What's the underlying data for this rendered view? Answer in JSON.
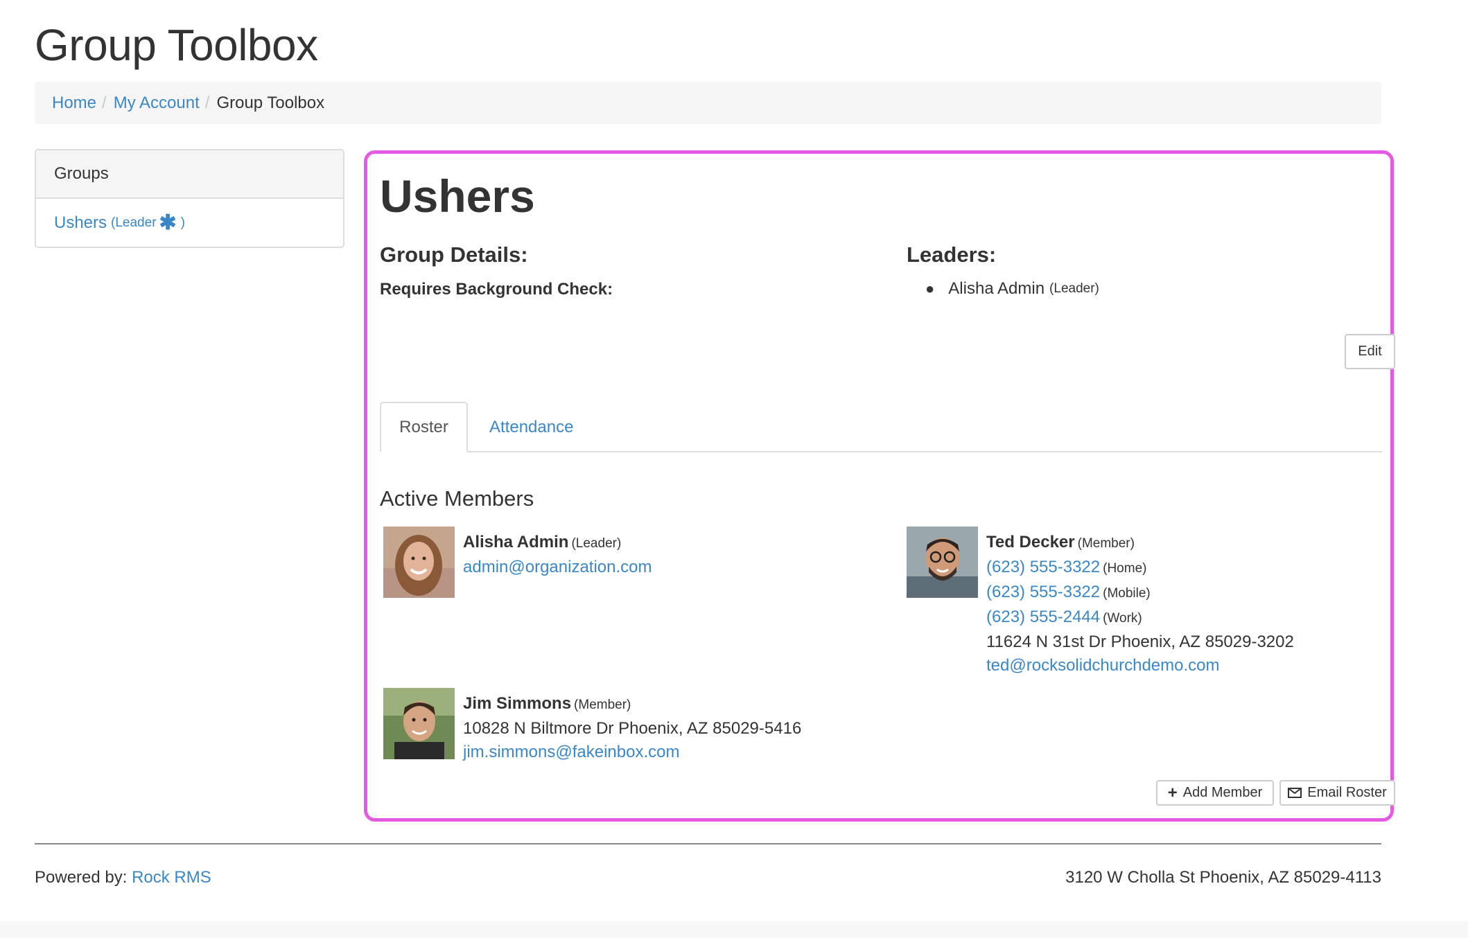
{
  "page": {
    "title": "Group Toolbox"
  },
  "breadcrumb": {
    "items": [
      "Home",
      "My Account"
    ],
    "current": "Group Toolbox",
    "separator": "/"
  },
  "groups_panel": {
    "heading": "Groups",
    "items": [
      {
        "name": "Ushers",
        "role": "(Leader",
        "star": "✱",
        "close": ")"
      }
    ]
  },
  "group": {
    "name": "Ushers",
    "details_heading": "Group Details:",
    "background_check_label": "Requires Background Check:",
    "leaders_heading": "Leaders:",
    "leaders": [
      {
        "name": "Alisha Admin",
        "role": "(Leader)"
      }
    ],
    "edit_label": "Edit"
  },
  "tabs": [
    {
      "label": "Roster",
      "active": true
    },
    {
      "label": "Attendance",
      "active": false
    }
  ],
  "roster": {
    "heading": "Active Members",
    "members": [
      {
        "name": "Alisha Admin",
        "role": "(Leader)",
        "email": "admin@organization.com"
      },
      {
        "name": "Ted Decker",
        "role": "(Member)",
        "phones": [
          {
            "number": "(623) 555-3322",
            "type": "(Home)"
          },
          {
            "number": "(623) 555-3322",
            "type": "(Mobile)"
          },
          {
            "number": "(623) 555-2444",
            "type": "(Work)"
          }
        ],
        "address": "11624 N 31st Dr Phoenix, AZ 85029-3202",
        "email": "ted@rocksolidchurchdemo.com"
      },
      {
        "name": "Jim Simmons",
        "role": "(Member)",
        "address": "10828 N Biltmore Dr Phoenix, AZ 85029-5416",
        "email": "jim.simmons@fakeinbox.com"
      }
    ],
    "add_member_label": "Add Member",
    "email_roster_label": "Email Roster"
  },
  "footer": {
    "powered_by_label": "Powered by:",
    "powered_by_link": "Rock RMS",
    "address": "3120 W Cholla St Phoenix, AZ 85029-4113"
  },
  "colors": {
    "link": "#3a87c8",
    "highlight_border": "#e55ae3",
    "text": "#333333"
  }
}
